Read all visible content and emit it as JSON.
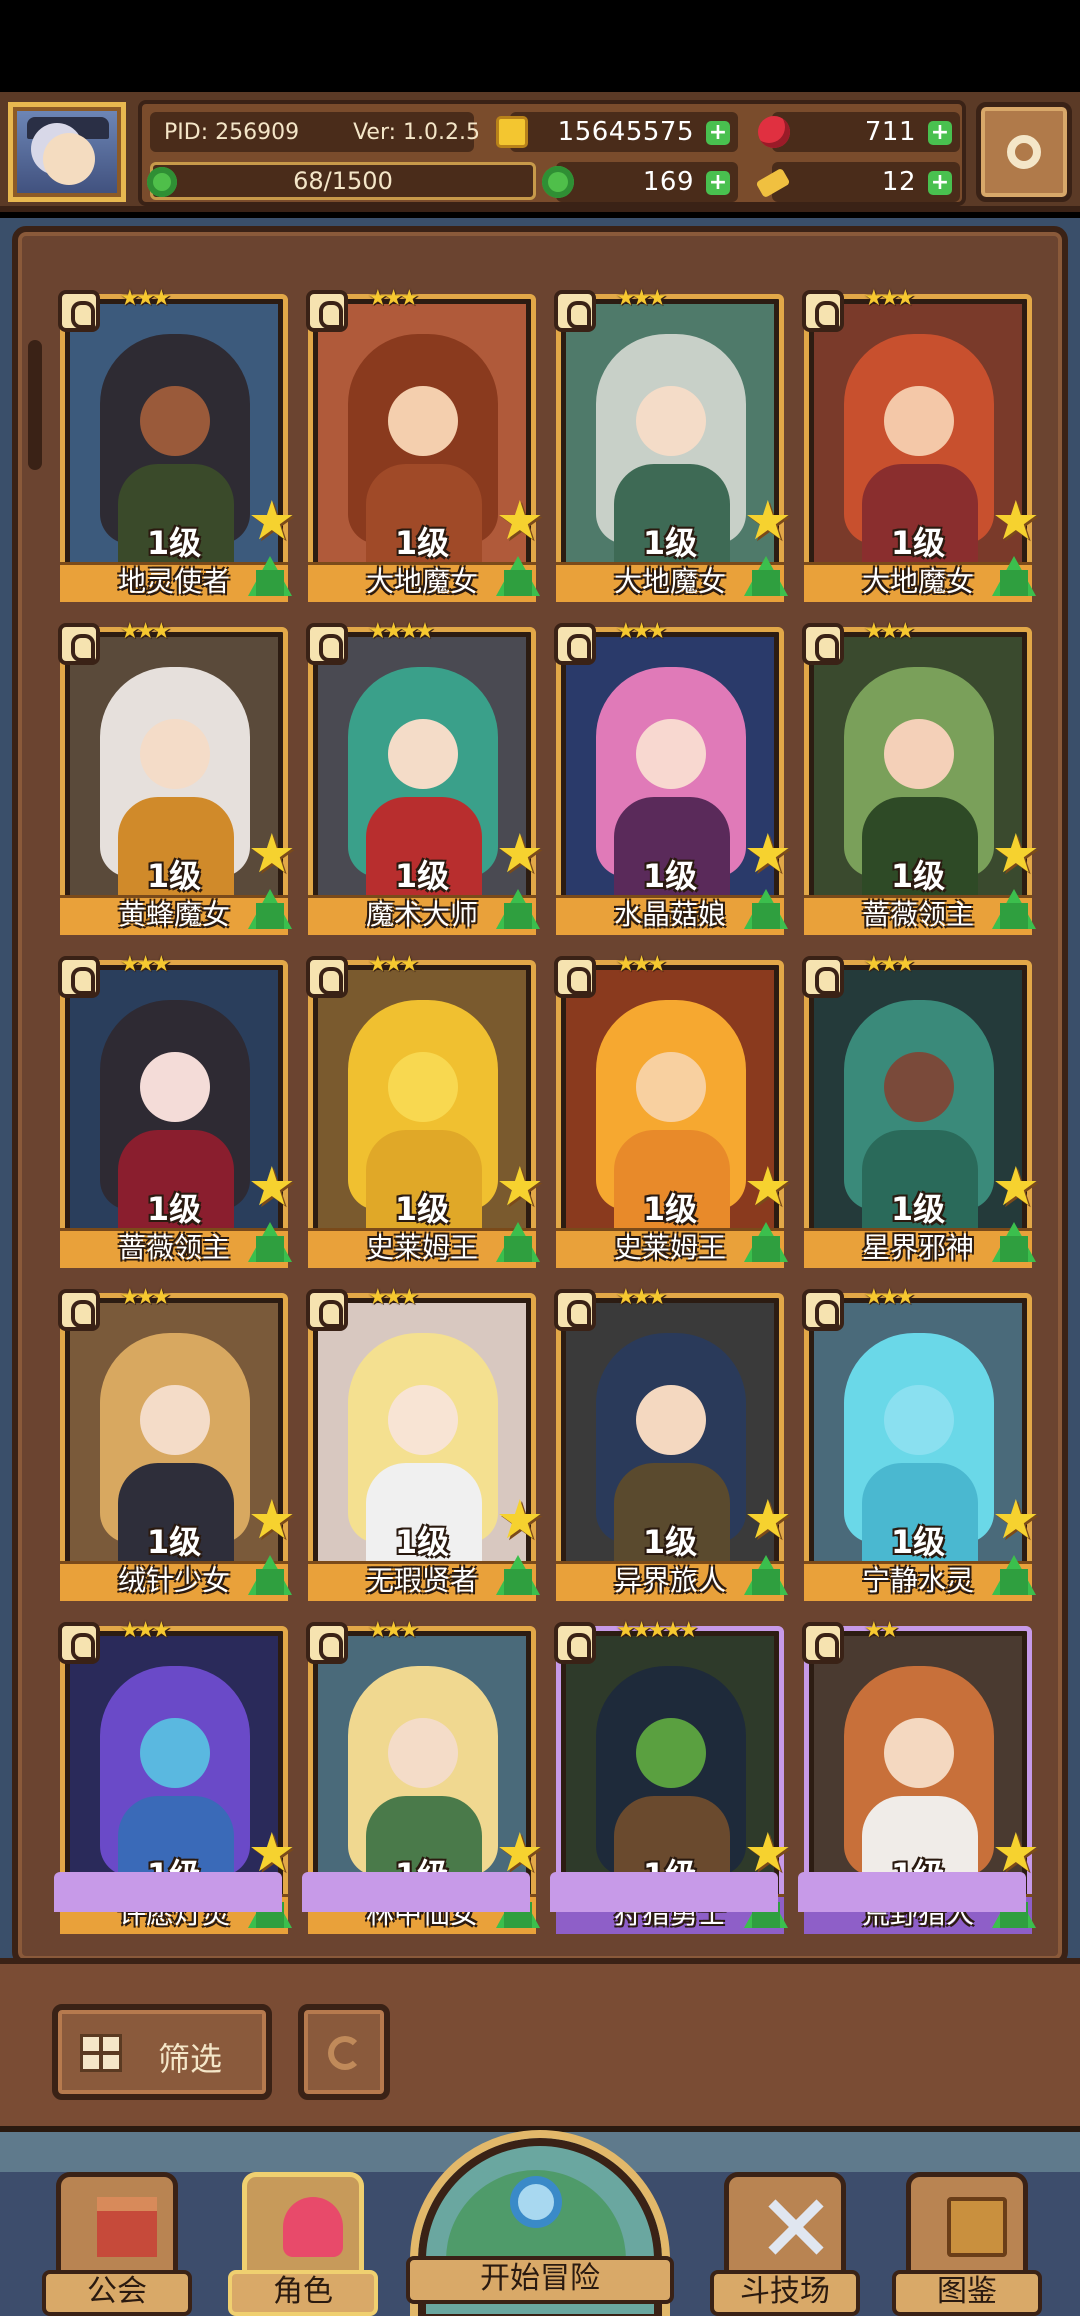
{
  "header": {
    "pid": "PID: 256909",
    "version": "Ver: 1.0.2.5",
    "gold": "15645575",
    "ruby": "711",
    "clover": "169",
    "key": "12",
    "stamina": "68/1500",
    "colors": {
      "panel": "#7a4c2c",
      "plus": "#49c04f"
    }
  },
  "cards": [
    {
      "level": "1级",
      "name": "地灵使者",
      "stars": "★★★",
      "rarity": "gold",
      "art": {
        "bg": "#3c5a7c",
        "hair": "#2e2b33",
        "face": "#9a5a3a",
        "body": "#3a4a2a"
      }
    },
    {
      "level": "1级",
      "name": "大地魔女",
      "stars": "★★★",
      "rarity": "gold",
      "art": {
        "bg": "#b05a3a",
        "hair": "#8a3a1e",
        "face": "#f4cfae",
        "body": "#a04a28"
      }
    },
    {
      "level": "1级",
      "name": "大地魔女",
      "stars": "★★★",
      "rarity": "gold",
      "art": {
        "bg": "#4f7a6a",
        "hair": "#c8d0c8",
        "face": "#f4dcc8",
        "body": "#3e6a55"
      }
    },
    {
      "level": "1级",
      "name": "大地魔女",
      "stars": "★★★",
      "rarity": "gold",
      "art": {
        "bg": "#7a3a2a",
        "hair": "#c8502e",
        "face": "#f4c8a8",
        "body": "#8a2e2e"
      }
    },
    {
      "level": "1级",
      "name": "黄蜂魔女",
      "stars": "★★★",
      "rarity": "gold",
      "art": {
        "bg": "#5a4a3a",
        "hair": "#e6e0dc",
        "face": "#f4dcc8",
        "body": "#d08a2a"
      }
    },
    {
      "level": "1级",
      "name": "魔术大师",
      "stars": "★★★★",
      "rarity": "gold",
      "art": {
        "bg": "#4a4a52",
        "hair": "#3aa08a",
        "face": "#f4dcc8",
        "body": "#b82e2e"
      }
    },
    {
      "level": "1级",
      "name": "水晶菇娘",
      "stars": "★★★",
      "rarity": "gold",
      "art": {
        "bg": "#2a3a6a",
        "hair": "#e07ab8",
        "face": "#f8d8d0",
        "body": "#5a2a5a"
      }
    },
    {
      "level": "1级",
      "name": "蔷薇领主",
      "stars": "★★★",
      "rarity": "gold",
      "art": {
        "bg": "#3a4a2e",
        "hair": "#7aa05a",
        "face": "#f4d0b8",
        "body": "#2e4a26"
      }
    },
    {
      "level": "1级",
      "name": "蔷薇领主",
      "stars": "★★★",
      "rarity": "gold",
      "art": {
        "bg": "#2a3e5c",
        "hair": "#2e2a33",
        "face": "#f4dcd8",
        "body": "#8a1e2e"
      }
    },
    {
      "level": "1级",
      "name": "史莱姆王",
      "stars": "★★★",
      "rarity": "gold",
      "art": {
        "bg": "#7a5a2e",
        "hair": "#f0c030",
        "face": "#f8d850",
        "body": "#e0a828"
      }
    },
    {
      "level": "1级",
      "name": "史莱姆王",
      "stars": "★★★",
      "rarity": "gold",
      "art": {
        "bg": "#8a3a1e",
        "hair": "#f6a830",
        "face": "#f8d0a0",
        "body": "#e88a2a"
      }
    },
    {
      "level": "1级",
      "name": "星界邪神",
      "stars": "★★★",
      "rarity": "gold",
      "art": {
        "bg": "#243a3a",
        "hair": "#3a8a7a",
        "face": "#7a4a3a",
        "body": "#2a6a5a"
      }
    },
    {
      "level": "1级",
      "name": "绒针少女",
      "stars": "★★★",
      "rarity": "gold",
      "art": {
        "bg": "#7a5a3a",
        "hair": "#d8a860",
        "face": "#f4dcc8",
        "body": "#2e2e3a"
      }
    },
    {
      "level": "1级",
      "name": "无瑕贤者",
      "stars": "★★★",
      "rarity": "gold",
      "art": {
        "bg": "#d8c8c0",
        "hair": "#f4e090",
        "face": "#f8e4d4",
        "body": "#f0f0f0"
      }
    },
    {
      "level": "1级",
      "name": "异界旅人",
      "stars": "★★★",
      "rarity": "gold",
      "art": {
        "bg": "#3a3a3a",
        "hair": "#2a3a5a",
        "face": "#f4d8c0",
        "body": "#5a4a2e"
      }
    },
    {
      "level": "1级",
      "name": "宁静水灵",
      "stars": "★★★",
      "rarity": "gold",
      "art": {
        "bg": "#4a6a7a",
        "hair": "#6ad8e8",
        "face": "#8ae0f0",
        "body": "#4ab8d0"
      }
    },
    {
      "level": "1级",
      "name": "许愿灯灵",
      "stars": "★★★",
      "rarity": "gold",
      "art": {
        "bg": "#2a2a5a",
        "hair": "#6a4ac8",
        "face": "#5ab8e0",
        "body": "#3a6ab8"
      }
    },
    {
      "level": "1级",
      "name": "林中仙女",
      "stars": "★★★",
      "rarity": "gold",
      "art": {
        "bg": "#4a6a7a",
        "hair": "#f0d890",
        "face": "#f4dcc8",
        "body": "#4a7a4a"
      }
    },
    {
      "level": "1级",
      "name": "狩猎勇士",
      "stars": "★★★★★",
      "rarity": "purple",
      "art": {
        "bg": "#2e3a2a",
        "hair": "#1e2a3a",
        "face": "#5aa040",
        "body": "#6a4a2e"
      }
    },
    {
      "level": "1级",
      "name": "荒野猎人",
      "stars": "★★",
      "rarity": "purple",
      "art": {
        "bg": "#4a3a30",
        "hair": "#c8703a",
        "face": "#f4d8c0",
        "body": "#f0ece8"
      }
    }
  ],
  "filter": {
    "label": "筛选"
  },
  "nav": {
    "guild": "公会",
    "character": "角色",
    "adventure": "开始冒险",
    "arena": "斗技场",
    "codex": "图鉴"
  }
}
